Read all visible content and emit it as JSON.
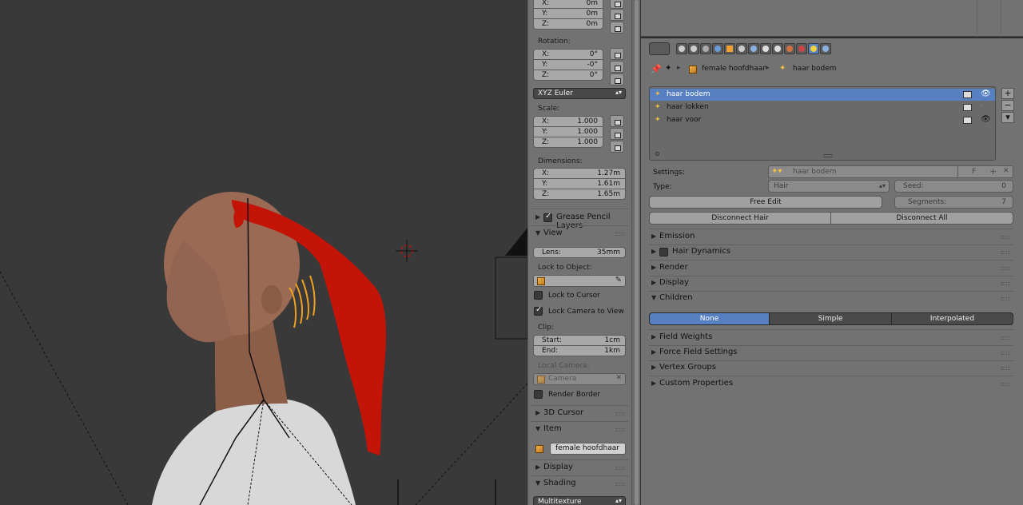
{
  "npanel": {
    "location_rows": [
      {
        "axis": "X:",
        "value": "0m"
      },
      {
        "axis": "Y:",
        "value": "0m"
      },
      {
        "axis": "Z:",
        "value": "0m"
      }
    ],
    "rotation_label": "Rotation:",
    "rotation_rows": [
      {
        "axis": "X:",
        "value": "0°"
      },
      {
        "axis": "Y:",
        "value": "-0°"
      },
      {
        "axis": "Z:",
        "value": "0°"
      }
    ],
    "rotation_mode": "XYZ Euler",
    "scale_label": "Scale:",
    "scale_rows": [
      {
        "axis": "X:",
        "value": "1.000"
      },
      {
        "axis": "Y:",
        "value": "1.000"
      },
      {
        "axis": "Z:",
        "value": "1.000"
      }
    ],
    "dimensions_label": "Dimensions:",
    "dimensions_rows": [
      {
        "axis": "X:",
        "value": "1.27m"
      },
      {
        "axis": "Y:",
        "value": "1.61m"
      },
      {
        "axis": "Z:",
        "value": "1.65m"
      }
    ],
    "grease_pencil_label": "Grease Pencil Layers",
    "view_label": "View",
    "lens_label": "Lens:",
    "lens_value": "35mm",
    "lock_to_object_label": "Lock to Object:",
    "lock_to_cursor_label": "Lock to Cursor",
    "lock_camera_label": "Lock Camera to View",
    "clip_label": "Clip:",
    "clip_start_label": "Start:",
    "clip_start_value": "1cm",
    "clip_end_label": "End:",
    "clip_end_value": "1km",
    "local_camera_label": "Local Camera:",
    "local_camera_value": "Camera",
    "render_border_label": "Render Border",
    "cursor_label": "3D Cursor",
    "item_label": "Item",
    "item_name": "female hoofdhaar",
    "display_label": "Display",
    "shading_label": "Shading",
    "shading_mode": "Multitexture"
  },
  "props": {
    "breadcrumb_object": "female hoofdhaar",
    "breadcrumb_psys": "haar bodem",
    "particle_systems": [
      {
        "name": "haar bodem",
        "selected": true
      },
      {
        "name": "haar lokken",
        "selected": false
      },
      {
        "name": "haar voor",
        "selected": false
      }
    ],
    "settings_label": "Settings:",
    "settings_value": "haar bodem",
    "settings_f": "F",
    "type_label": "Type:",
    "type_value": "Hair",
    "seed_label": "Seed:",
    "seed_value": "0",
    "free_edit_label": "Free Edit",
    "segments_label": "Segments:",
    "segments_value": "7",
    "disconnect_hair_label": "Disconnect Hair",
    "disconnect_all_label": "Disconnect All",
    "sections": {
      "emission": "Emission",
      "hair_dynamics": "Hair Dynamics",
      "render": "Render",
      "display": "Display",
      "children": "Children",
      "field_weights": "Field Weights",
      "force_field": "Force Field Settings",
      "vertex_groups": "Vertex Groups",
      "custom_props": "Custom Properties"
    },
    "children_modes": [
      "None",
      "Simple",
      "Interpolated"
    ],
    "children_active": "None"
  },
  "colors": {
    "accent": "#5680c2",
    "panel_bg": "#727272",
    "viewport_bg": "#393939",
    "hair_red": "#c41408"
  }
}
